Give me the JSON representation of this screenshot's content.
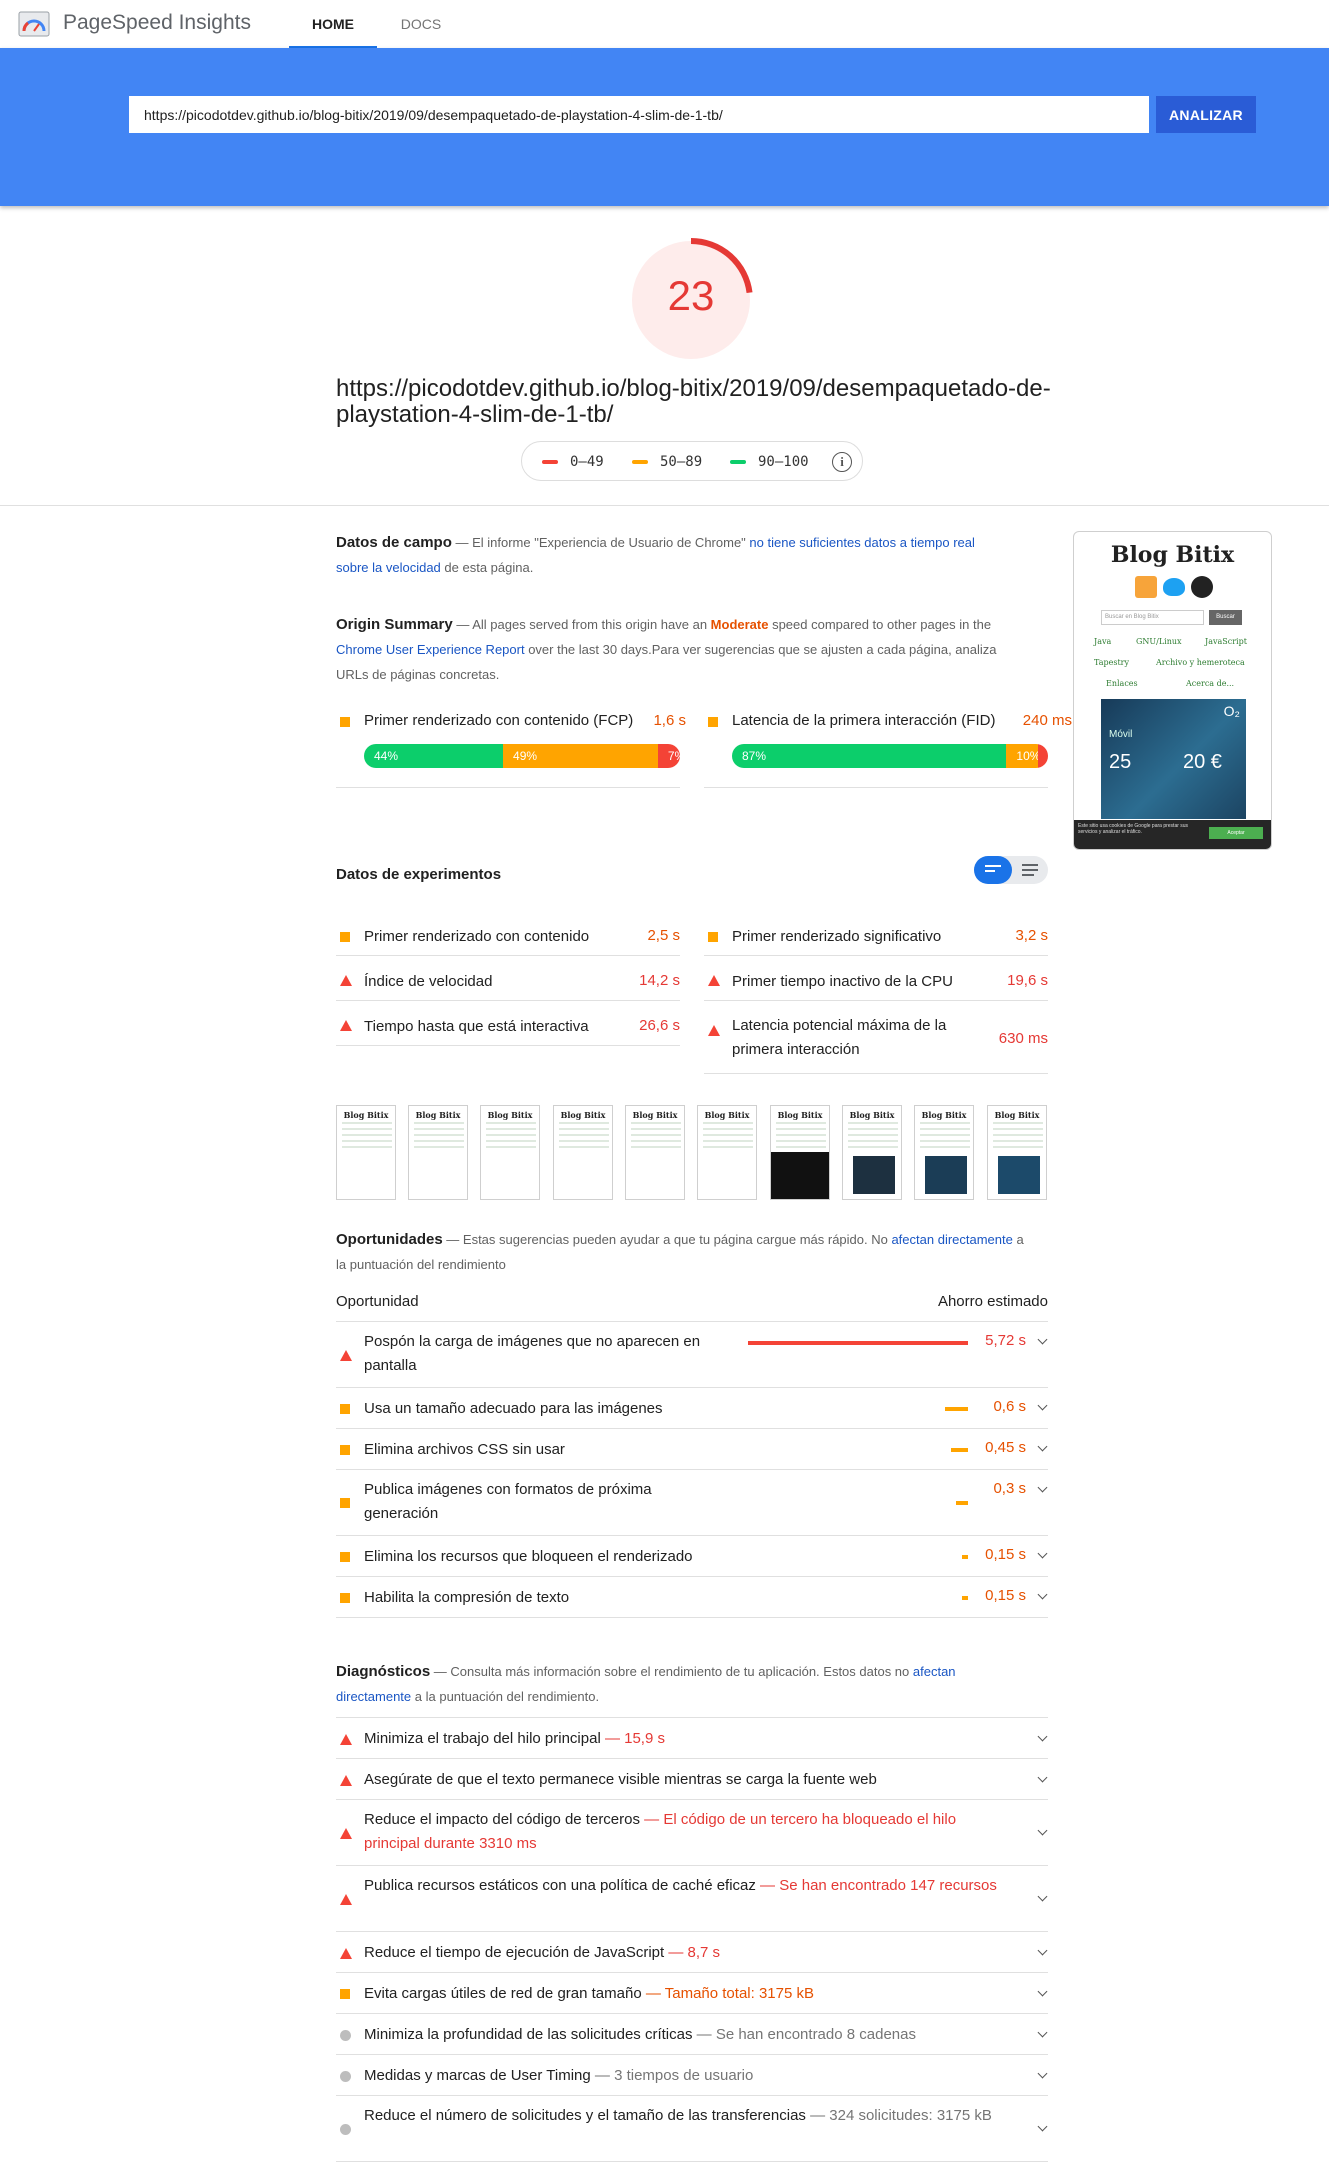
{
  "app": {
    "title": "PageSpeed Insights"
  },
  "nav": {
    "tabs": [
      {
        "label": "HOME"
      },
      {
        "label": "DOCS"
      }
    ]
  },
  "search": {
    "url": "https://picodotdev.github.io/blog-bitix/2019/09/desempaquetado-de-playstation-4-slim-de-1-tb/",
    "button": "ANALIZAR"
  },
  "score": {
    "value": "23",
    "fraction": 0.23,
    "color": "#e53935"
  },
  "page": {
    "url": "https://picodotdev.github.io/blog-bitix/2019/09/desempaquetado-de-playstation-4-slim-de-1-tb/"
  },
  "legend": [
    {
      "label": "0–49",
      "color": "#f44336"
    },
    {
      "label": "50–89",
      "color": "#ffa400"
    },
    {
      "label": "90–100",
      "color": "#0cce6b"
    }
  ],
  "field_data": {
    "title": "Datos de campo",
    "text_a": " — El informe \"Experiencia de Usuario de Chrome\" ",
    "link": "no tiene suficientes datos a tiempo real sobre la velocidad",
    "text_b": " de esta página."
  },
  "origin": {
    "title": "Origin Summary",
    "text_a": " — All pages served from this origin have an ",
    "speed": "Moderate",
    "text_b": " speed compared to other pages in the ",
    "link": "Chrome User Experience Report",
    "text_c": " over the last 30 days.Para ver sugerencias que se ajusten a cada página, analiza URLs de páginas concretas.",
    "metrics": [
      {
        "label": "Primer renderizado con contenido (FCP)",
        "value": "1,6 s",
        "fast": "44%",
        "avg": "49%",
        "slow": "7%",
        "fast_pct": 44,
        "avg_pct": 49,
        "slow_pct": 7
      },
      {
        "label": "Latencia de la primera interacción (FID)",
        "value": "240 ms",
        "fast": "87%",
        "avg": "10%",
        "slow": "3%",
        "fast_pct": 87,
        "avg_pct": 10,
        "slow_pct": 3
      }
    ]
  },
  "screenshot": {
    "blog_title": "Blog Bitix",
    "search_placeholder": "Buscar en Blog Bitix",
    "search_button": "Buscar",
    "links": [
      "Java",
      "GNU/Linux",
      "JavaScript",
      "Tapestry",
      "Archivo y hemeroteca",
      "Enlaces",
      "Acerca de..."
    ],
    "ad_brand": "O₂",
    "ad_text1": "Móvil",
    "ad_text2": "25",
    "ad_text3": "20 €",
    "cookie_text": "Este sitio usa cookies de Google para prestar sus servicios y analizar el tráfico.",
    "cookie_button": "Aceptar"
  },
  "lab": {
    "title": "Datos de experimentos",
    "metrics": [
      {
        "label": "Primer renderizado con contenido",
        "value": "2,5 s",
        "status": "average"
      },
      {
        "label": "Primer renderizado significativo",
        "value": "3,2 s",
        "status": "average"
      },
      {
        "label": "Índice de velocidad",
        "value": "14,2 s",
        "status": "fail"
      },
      {
        "label": "Primer tiempo inactivo de la CPU",
        "value": "19,6 s",
        "status": "fail"
      },
      {
        "label": "Tiempo hasta que está interactiva",
        "value": "26,6 s",
        "status": "fail"
      },
      {
        "label": "Latencia potencial máxima de la primera interacción",
        "value": "630 ms",
        "status": "fail"
      }
    ]
  },
  "filmstrip": {
    "frame_title": "Blog Bitix"
  },
  "opportunities": {
    "title": "Oportunidades",
    "desc_a": " — Estas sugerencias pueden ayudar a que tu página cargue más rápido. No ",
    "desc_link": "afectan directamente",
    "desc_b": " a la puntuación del rendimiento",
    "col_left": "Oportunidad",
    "col_right": "Ahorro estimado",
    "items": [
      {
        "label": "Pospón la carga de imágenes que no aparecen en pantalla",
        "saving": "5,72 s",
        "status": "fail",
        "seconds": 5.72
      },
      {
        "label": "Usa un tamaño adecuado para las imágenes",
        "saving": "0,6 s",
        "status": "average",
        "seconds": 0.6
      },
      {
        "label": "Elimina archivos CSS sin usar",
        "saving": "0,45 s",
        "status": "average",
        "seconds": 0.45
      },
      {
        "label": "Publica imágenes con formatos de próxima generación",
        "saving": "0,3 s",
        "status": "average",
        "seconds": 0.3
      },
      {
        "label": "Elimina los recursos que bloqueen el renderizado",
        "saving": "0,15 s",
        "status": "average",
        "seconds": 0.15
      },
      {
        "label": "Habilita la compresión de texto",
        "saving": "0,15 s",
        "status": "average",
        "seconds": 0.15
      }
    ]
  },
  "diagnostics": {
    "title": "Diagnósticos",
    "desc_a": " — Consulta más información sobre el rendimiento de tu aplicación. Estos datos no ",
    "desc_link": "afectan directamente",
    "desc_b": " a la puntuación del rendimiento.",
    "items": [
      {
        "label": "Minimiza el trabajo del hilo principal",
        "detail": " — 15,9 s",
        "status": "fail"
      },
      {
        "label": "Asegúrate de que el texto permanece visible mientras se carga la fuente web",
        "detail": "",
        "status": "fail"
      },
      {
        "label": "Reduce el impacto del código de terceros",
        "detail": " — El código de un tercero ha bloqueado el hilo principal durante 3310 ms",
        "status": "fail"
      },
      {
        "label": "Publica recursos estáticos con una política de caché eficaz",
        "detail": " — Se han encontrado 147 recursos",
        "status": "fail"
      },
      {
        "label": "Reduce el tiempo de ejecución de JavaScript",
        "detail": " — 8,7 s",
        "status": "fail"
      },
      {
        "label": "Evita cargas útiles de red de gran tamaño",
        "detail": " — Tamaño total: 3175 kB",
        "status": "average"
      },
      {
        "label": "Minimiza la profundidad de las solicitudes críticas",
        "detail": " — Se han encontrado 8 cadenas",
        "status": "info"
      },
      {
        "label": "Medidas y marcas de User Timing",
        "detail": " — 3 tiempos de usuario",
        "status": "info"
      },
      {
        "label": "Reduce el número de solicitudes y el tamaño de las transferencias",
        "detail": " — 324 solicitudes: 3175 kB",
        "status": "info"
      }
    ]
  }
}
